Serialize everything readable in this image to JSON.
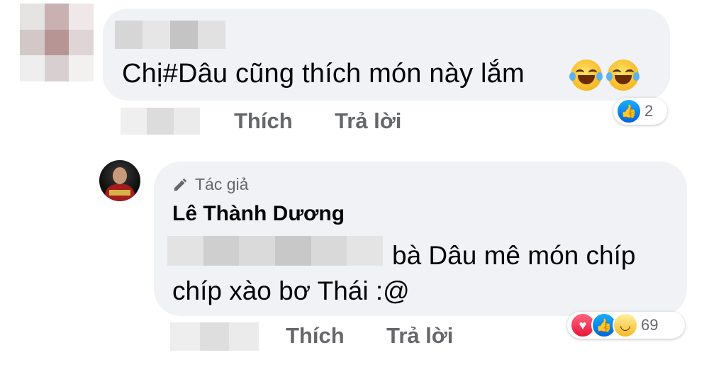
{
  "comment1": {
    "text": "Chị#Dâu cũng thích món này lắm",
    "emojis": [
      "rofl-emoji",
      "rofl-emoji"
    ],
    "actions": {
      "like": "Thích",
      "reply": "Trả lời"
    },
    "reactions": {
      "types": [
        "like"
      ],
      "count": "2"
    }
  },
  "comment2": {
    "badge": "Tác giả",
    "author": "Lê Thành Dương",
    "line1": "bà Dâu mê món chíp",
    "line2": "chíp xào bơ Thái :@",
    "actions": {
      "like": "Thích",
      "reply": "Trả lời"
    },
    "reactions": {
      "types": [
        "love",
        "like",
        "haha"
      ],
      "count": "69"
    }
  },
  "colors": {
    "bubble": "#f0f2f5",
    "action_text": "#65676b",
    "like_blue": "#0062df",
    "love_red": "#e61739",
    "haha_yellow": "#f7b924"
  }
}
